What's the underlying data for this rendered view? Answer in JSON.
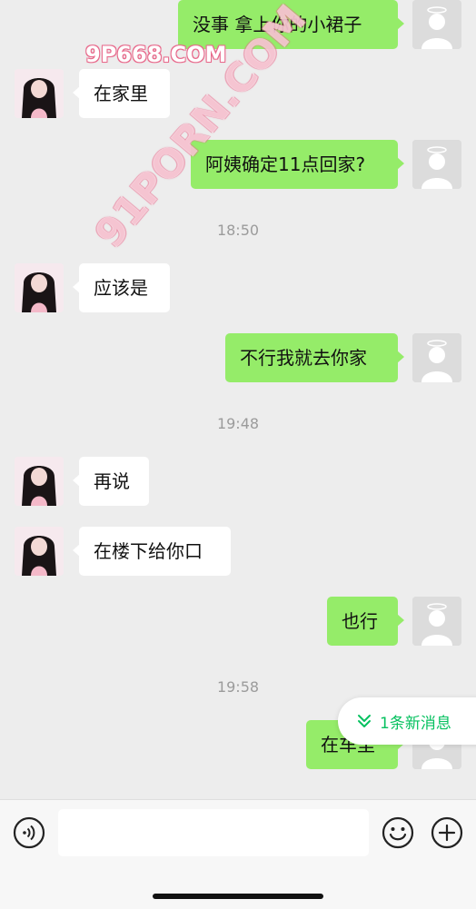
{
  "watermarks": [
    "9P668.COM",
    "91PORN.COM"
  ],
  "messages": [
    {
      "side": "me",
      "text": "没事 拿上你的小裙子"
    },
    {
      "side": "them",
      "text": "在家里"
    },
    {
      "side": "me",
      "text": "阿姨确定11点回家?"
    },
    {
      "side": "them",
      "text": "应该是"
    },
    {
      "side": "me",
      "text": "不行我就去你家"
    },
    {
      "side": "them",
      "text": "再说"
    },
    {
      "side": "them",
      "text": "在楼下给你口"
    },
    {
      "side": "me",
      "text": "也行"
    },
    {
      "side": "me",
      "text": "在车里"
    }
  ],
  "timestamps": [
    "18:50",
    "19:48",
    "19:58"
  ],
  "new_message_badge": "1条新消息",
  "input": {
    "value": "",
    "placeholder": ""
  },
  "colors": {
    "my_bubble": "#95ec69",
    "their_bubble": "#ffffff",
    "background": "#ededed",
    "accent": "#07c160"
  },
  "icons": [
    "voice-icon",
    "emoji-icon",
    "plus-icon",
    "chevron-double-down-icon"
  ]
}
